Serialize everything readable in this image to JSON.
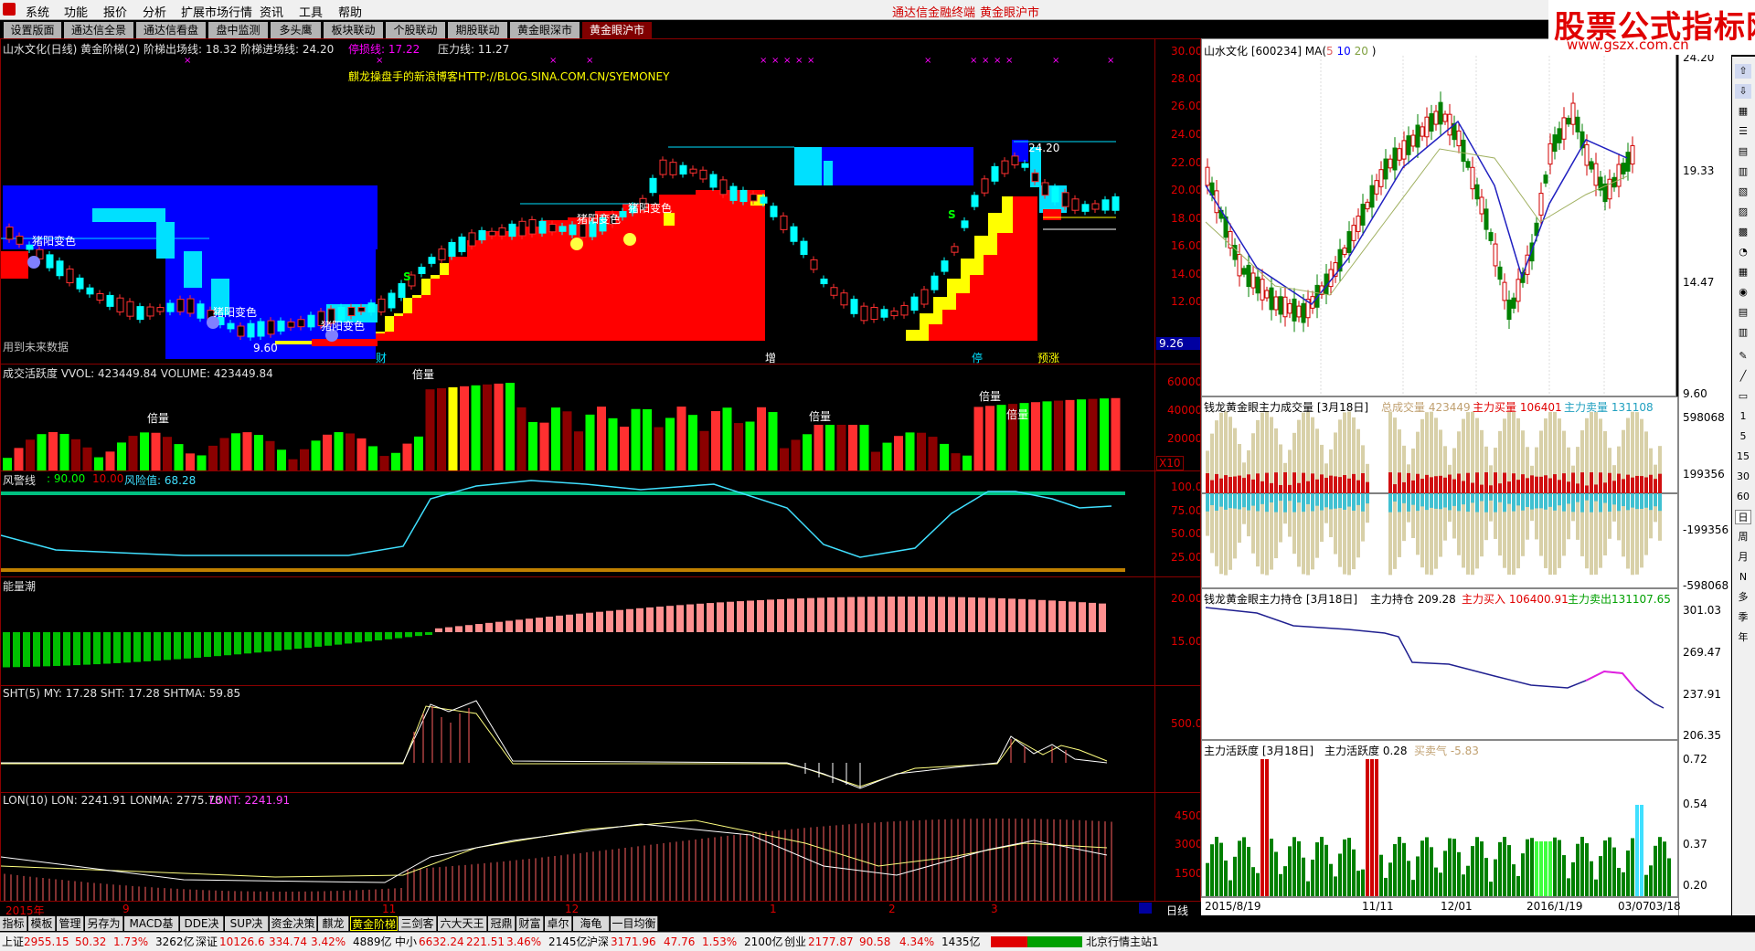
{
  "menubar": {
    "items": [
      "系统",
      "功能",
      "报价",
      "分析",
      "扩展市场行情",
      "资讯",
      "工具",
      "帮助"
    ],
    "center1": "通达信金融终端",
    "center2": "黄金眼沪市"
  },
  "watermark": {
    "line1": "股票公式指标网",
    "line2": "www.gszx.com.cn"
  },
  "tabs": [
    "设置版面",
    "通达信全景",
    "通达信看盘",
    "盘中监测",
    "多头鹰",
    "板块联动",
    "个股联动",
    "期股联动",
    "黄金眼深市",
    "黄金眼沪市"
  ],
  "main": {
    "title": "山水文化(日线) 黄金阶梯(2) 阶梯出场线: 18.32  阶梯进场线: 24.20",
    "stop": "停损线: 17.22",
    "press": "压力线: 11.27",
    "blog": "麒龙操盘手的新浪博客HTTP://BLOG.SINA.COM.CN/SYEMONEY",
    "future": "用到未来数据",
    "labels": [
      "猪阳变色",
      "猪阳变色",
      "猪阳变色",
      "猪阳变色",
      "猪阳变色"
    ],
    "marks": [
      "财",
      "增",
      "停",
      "预涨"
    ],
    "lowval": "9.60",
    "hiend": "24.20",
    "axis": [
      "30.00",
      "28.00",
      "26.00",
      "24.00",
      "22.00",
      "20.00",
      "18.00",
      "16.00",
      "14.00",
      "12.00"
    ],
    "axisval": "9.26"
  },
  "vol": {
    "title": "成交活跃度 VVOL: 423449.84  VOLUME: 423449.84",
    "axis": [
      "60000",
      "40000",
      "20000"
    ],
    "unit": "X10",
    "labels": [
      "倍量",
      "倍量",
      "倍量",
      "倍量",
      "倍量"
    ]
  },
  "risk": {
    "title": "风警线",
    "v1": ": 90.00",
    "v2": "10.00",
    "v3": "风险值: 68.28",
    "axis": [
      "100.0",
      "75.00",
      "50.00",
      "25.00"
    ]
  },
  "energy": {
    "title": "能量潮",
    "axis": [
      "20.00",
      "15.00"
    ]
  },
  "sht": {
    "title": "SHT(5)  MY: 17.28  SHT: 17.28  SHTMA: 59.85",
    "axis": [
      "500.0"
    ]
  },
  "lon": {
    "title": "LON(10)  LON: 2241.91  LONMA: 2775.78  ",
    "lont": "LONT: 2241.91",
    "axis": [
      "4500",
      "3000",
      "1500"
    ]
  },
  "xaxis": {
    "labels": [
      "2015年",
      "9",
      "11",
      "12",
      "1",
      "2",
      "3"
    ],
    "cycle": "日线"
  },
  "right": {
    "k": {
      "title": "山水文化 [600234] MA(",
      "ma": [
        "5",
        "10",
        "20"
      ],
      "close": ")",
      "axis": [
        "24.20",
        "19.33",
        "14.47",
        "9.60"
      ]
    },
    "p2": {
      "title": "钱龙黄金眼主力成交量 [3月18日]",
      "a": "总成交量 423449",
      "b": "主力买量 106401",
      "c": "主力卖量 131108",
      "axis": [
        "598068",
        "199356",
        "-199356",
        "-598068"
      ]
    },
    "p3": {
      "title": "钱龙黄金眼主力持仓 [3月18日]",
      "a": "主力持仓 209.28",
      "b": "主力买入 106400.91",
      "c": "主力卖出131107.65",
      "axis": [
        "301.03",
        "269.47",
        "237.91",
        "206.35"
      ]
    },
    "p4": {
      "title": "主力活跃度 [3月18日]",
      "a": "主力活跃度 0.28",
      "b": "买卖气 -5.83",
      "axis": [
        "0.72",
        "0.54",
        "0.37",
        "0.20"
      ]
    },
    "dates": [
      "2015/8/19",
      "11/11",
      "12/01",
      "2016/1/19",
      "03/07",
      "03/18"
    ]
  },
  "rtool": [
    "1",
    "5",
    "15",
    "30",
    "60",
    "日",
    "周",
    "月",
    "N",
    "多",
    "季",
    "年"
  ],
  "bottomtabs": [
    "指标",
    "模板",
    "管理",
    "另存为",
    "MACD基本",
    "DDE决策",
    "SUP决策",
    "资金决策",
    "麒龙",
    "黄金阶梯",
    "三剑客",
    "六大天王",
    "冠鼎",
    "财富",
    "卓尔",
    "海龟",
    "一目均衡"
  ],
  "status": {
    "sh": "上证",
    "sh_v": "2955.15",
    "sh_c": "50.32",
    "sh_p": "1.73%",
    "sh_a": "3262亿",
    "sz": "深证",
    "sz_v": "10126.6",
    "sz_c": "334.74",
    "sz_p": "3.42%",
    "sz_a": "4889亿",
    "zx": "中小",
    "zx_v": "6632.24",
    "zx_c": "221.51",
    "zx_p": "3.46%",
    "zx_a": "2145亿",
    "hs": "沪深",
    "hs_v": "3171.96",
    "hs_c": "47.76",
    "hs_p": "1.53%",
    "hs_a": "2100亿",
    "cy": "创业",
    "cy_v": "2177.87",
    "cy_c": "90.58",
    "cy_p": "4.34%",
    "cy_a": "1435亿",
    "station": "北京行情主站1"
  },
  "colors": {
    "up": "#ff3030",
    "down": "#00ffff",
    "blue": "#0000ff",
    "yellow": "#ffff00",
    "cyan": "#40e0ff",
    "frame": "#8b0000"
  }
}
